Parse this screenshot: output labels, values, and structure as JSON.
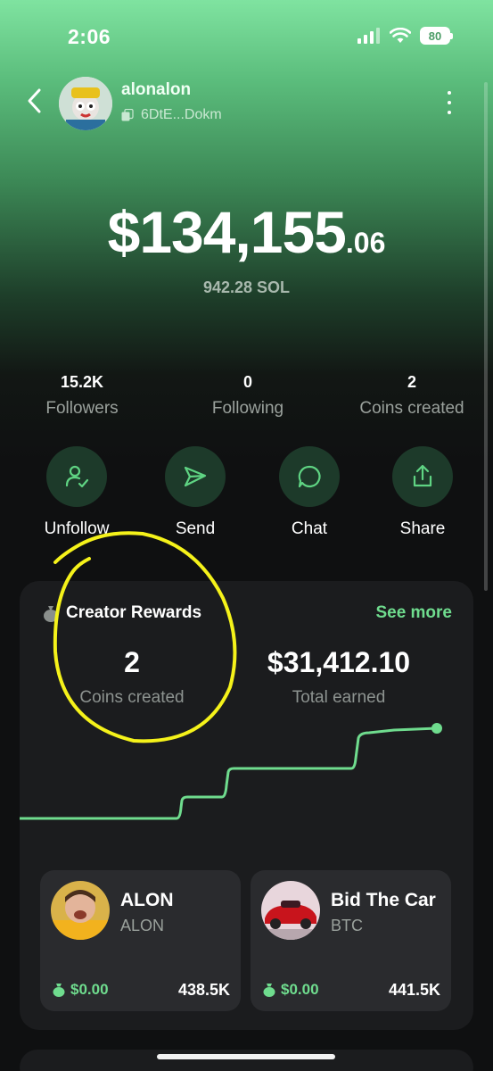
{
  "status_bar": {
    "time": "2:06",
    "battery": "80"
  },
  "profile": {
    "username": "alonalon",
    "wallet": "6DtE...Dokm"
  },
  "balance": {
    "usd_main": "$134,155",
    "usd_cents": ".06",
    "sol": "942.28 SOL"
  },
  "stats": [
    {
      "value": "15.2K",
      "label": "Followers"
    },
    {
      "value": "0",
      "label": "Following"
    },
    {
      "value": "2",
      "label": "Coins created"
    }
  ],
  "actions": [
    {
      "label": "Unfollow",
      "icon": "user-check-icon"
    },
    {
      "label": "Send",
      "icon": "send-icon"
    },
    {
      "label": "Chat",
      "icon": "chat-bubble-icon"
    },
    {
      "label": "Share",
      "icon": "share-icon"
    }
  ],
  "creator_rewards": {
    "title": "Creator Rewards",
    "see_more": "See more",
    "coins_created": {
      "value": "2",
      "label": "Coins created"
    },
    "total_earned": {
      "value": "$31,412.10",
      "label": "Total earned"
    }
  },
  "coins": [
    {
      "name": "ALON",
      "ticker": "ALON",
      "earned": "$0.00",
      "market_cap": "438.5K"
    },
    {
      "name": "Bid The Car",
      "ticker": "BTC",
      "earned": "$0.00",
      "market_cap": "441.5K"
    }
  ],
  "colors": {
    "accent": "#6fdc8e",
    "card": "#1b1c1e",
    "annotation": "#f5f21a"
  }
}
